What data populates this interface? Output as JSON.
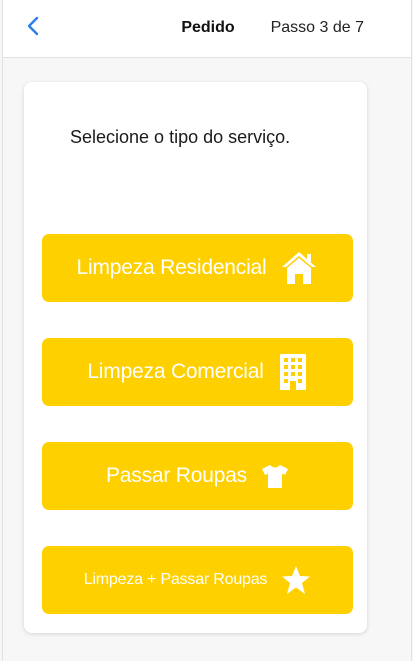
{
  "header": {
    "back_icon": "chevron-left-icon",
    "title": "Pedido",
    "step": "Passo 3 de 7"
  },
  "prompt": "Selecione o tipo do serviço.",
  "services": [
    {
      "label": "Limpeza Residencial",
      "icon": "house-icon"
    },
    {
      "label": "Limpeza Comercial",
      "icon": "building-icon"
    },
    {
      "label": "Passar Roupas",
      "icon": "shirt-icon"
    },
    {
      "label": "Limpeza + Passar Roupas",
      "icon": "star-icon"
    }
  ],
  "colors": {
    "accent": "#ffd000",
    "back_icon": "#2b7de9",
    "button_text": "#ffffff"
  }
}
